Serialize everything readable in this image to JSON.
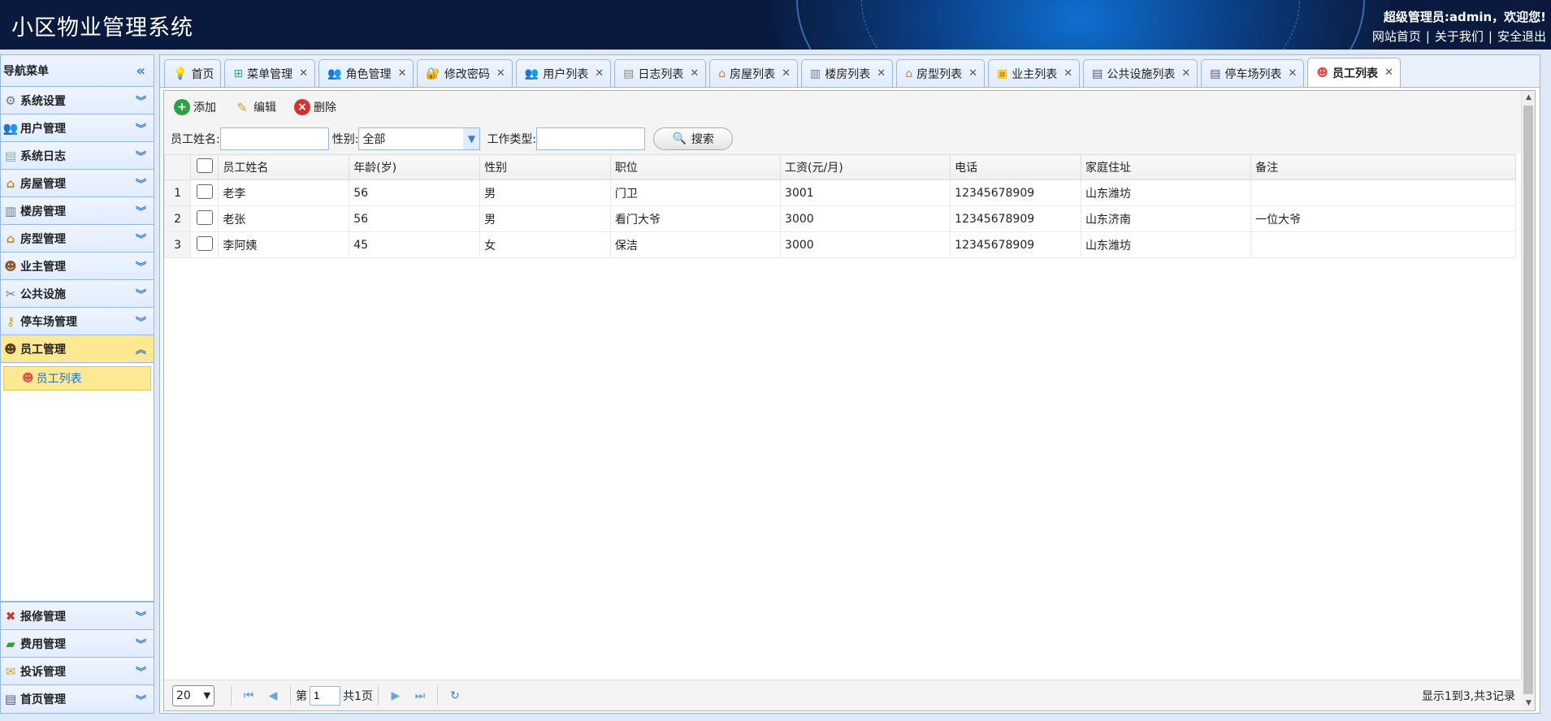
{
  "header": {
    "title": "小区物业管理系统",
    "welcome": "超级管理员:admin，欢迎您!",
    "links": [
      "网站首页",
      "关于我们",
      "安全退出"
    ]
  },
  "sidebar": {
    "title": "导航菜单",
    "menus": [
      {
        "label": "系统设置",
        "icon": "gear-icon"
      },
      {
        "label": "用户管理",
        "icon": "users-icon"
      },
      {
        "label": "系统日志",
        "icon": "log-icon"
      },
      {
        "label": "房屋管理",
        "icon": "house-icon"
      },
      {
        "label": "楼房管理",
        "icon": "building-icon"
      },
      {
        "label": "房型管理",
        "icon": "house-type-icon"
      },
      {
        "label": "业主管理",
        "icon": "owner-icon"
      },
      {
        "label": "公共设施",
        "icon": "tools-icon"
      },
      {
        "label": "停车场管理",
        "icon": "key-icon"
      },
      {
        "label": "员工管理",
        "icon": "staff-icon"
      }
    ],
    "active_sub": "员工列表",
    "bottom_menus": [
      {
        "label": "报修管理",
        "icon": "repair-icon"
      },
      {
        "label": "费用管理",
        "icon": "money-icon"
      },
      {
        "label": "投诉管理",
        "icon": "complaint-icon"
      },
      {
        "label": "首页管理",
        "icon": "homepage-icon"
      }
    ]
  },
  "tabs": [
    {
      "label": "首页",
      "icon": "lightbulb-icon",
      "closable": false
    },
    {
      "label": "菜单管理",
      "icon": "sitemap-icon",
      "closable": true
    },
    {
      "label": "角色管理",
      "icon": "role-icon",
      "closable": true
    },
    {
      "label": "修改密码",
      "icon": "password-icon",
      "closable": true
    },
    {
      "label": "用户列表",
      "icon": "users-icon",
      "closable": true
    },
    {
      "label": "日志列表",
      "icon": "log-icon",
      "closable": true
    },
    {
      "label": "房屋列表",
      "icon": "house-icon",
      "closable": true
    },
    {
      "label": "楼房列表",
      "icon": "building-icon",
      "closable": true
    },
    {
      "label": "房型列表",
      "icon": "house-type-icon",
      "closable": true
    },
    {
      "label": "业主列表",
      "icon": "owner-icon",
      "closable": true
    },
    {
      "label": "公共设施列表",
      "icon": "list-icon",
      "closable": true
    },
    {
      "label": "停车场列表",
      "icon": "list-icon",
      "closable": true
    },
    {
      "label": "员工列表",
      "icon": "staff-icon",
      "closable": true,
      "active": true
    }
  ],
  "toolbar": {
    "add": "添加",
    "edit": "编辑",
    "delete": "删除"
  },
  "search": {
    "name_label": "员工姓名:",
    "gender_label": "性别:",
    "gender_value": "全部",
    "worktype_label": "工作类型:",
    "button": "搜索"
  },
  "table": {
    "columns": [
      "员工姓名",
      "年龄(岁)",
      "性别",
      "职位",
      "工资(元/月)",
      "电话",
      "家庭住址",
      "备注"
    ],
    "rows": [
      {
        "n": "1",
        "cells": [
          "老李",
          "56",
          "男",
          "门卫",
          "3001",
          "12345678909",
          "山东潍坊",
          ""
        ]
      },
      {
        "n": "2",
        "cells": [
          "老张",
          "56",
          "男",
          "看门大爷",
          "3000",
          "12345678909",
          "山东济南",
          "一位大爷"
        ]
      },
      {
        "n": "3",
        "cells": [
          "李阿姨",
          "45",
          "女",
          "保洁",
          "3000",
          "12345678909",
          "山东潍坊",
          ""
        ]
      }
    ]
  },
  "pager": {
    "page_size": "20",
    "page_prefix": "第",
    "page_value": "1",
    "page_total": "共1页",
    "info": "显示1到3,共3记录"
  }
}
